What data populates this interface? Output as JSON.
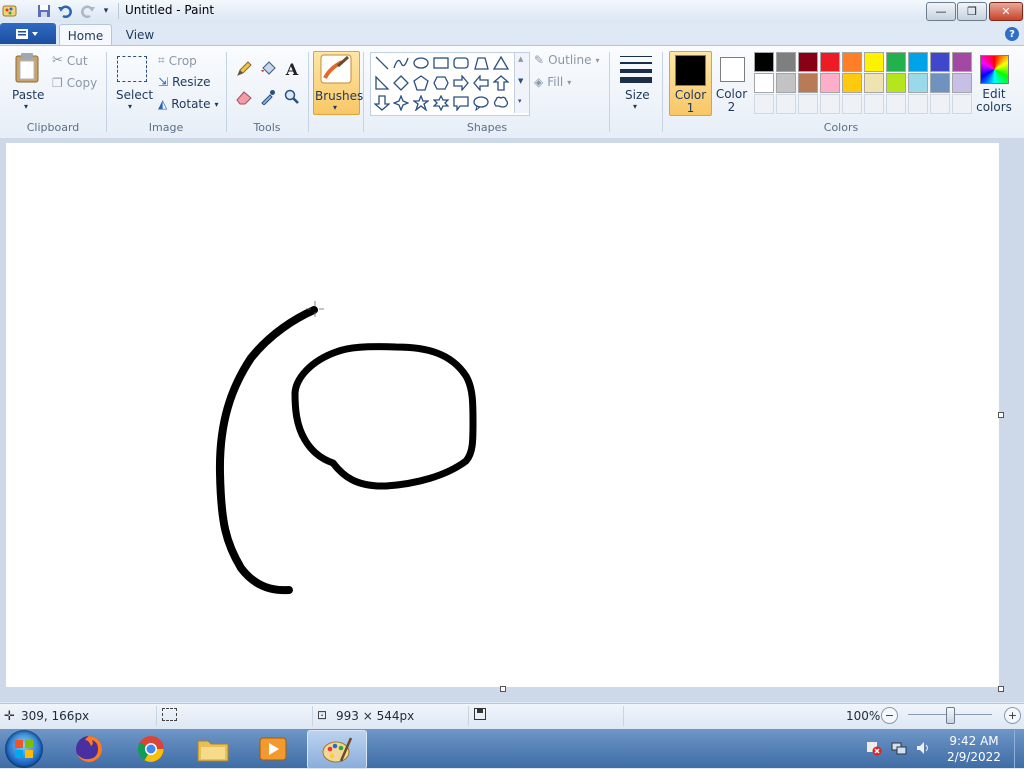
{
  "window": {
    "title": "Untitled - Paint",
    "controls": {
      "minimize": "—",
      "maximize": "❐",
      "close": "✕"
    }
  },
  "tabs": {
    "home": "Home",
    "view": "View"
  },
  "ribbon": {
    "clipboard": {
      "label": "Clipboard",
      "paste": "Paste",
      "cut": "Cut",
      "copy": "Copy"
    },
    "image": {
      "label": "Image",
      "select": "Select",
      "crop": "Crop",
      "resize": "Resize",
      "rotate": "Rotate"
    },
    "tools": {
      "label": "Tools"
    },
    "brushes": {
      "label": "Brushes"
    },
    "shapes": {
      "label": "Shapes",
      "outline": "Outline",
      "fill": "Fill"
    },
    "size": {
      "label": "Size"
    },
    "colors": {
      "label": "Colors",
      "color1": "Color\n1",
      "color1_line1": "Color",
      "color1_line2": "1",
      "color2_line1": "Color",
      "color2_line2": "2",
      "edit_line1": "Edit",
      "edit_line2": "colors",
      "color1_value": "#000000",
      "color2_value": "#ffffff",
      "palette_row1": [
        "#000000",
        "#7f7f7f",
        "#880015",
        "#ed1c24",
        "#ff7f27",
        "#fff200",
        "#22b14c",
        "#00a2e8",
        "#3f48cc",
        "#a349a4"
      ],
      "palette_row2": [
        "#ffffff",
        "#c3c3c3",
        "#b97a57",
        "#ffaec9",
        "#ffc90e",
        "#efe4b0",
        "#b5e61d",
        "#99d9ea",
        "#7092be",
        "#c8bfe7"
      ]
    }
  },
  "status": {
    "cursor_pos": "309, 166px",
    "canvas_size": "993 × 544px",
    "zoom": "100%",
    "zoom_level": 1.0
  },
  "taskbar": {
    "time": "9:42 AM",
    "date": "2/9/2022"
  },
  "colors": {
    "accent": "#f8c766",
    "ribbon_bg": "#e7eef7",
    "taskbar": "#3f6da6"
  }
}
